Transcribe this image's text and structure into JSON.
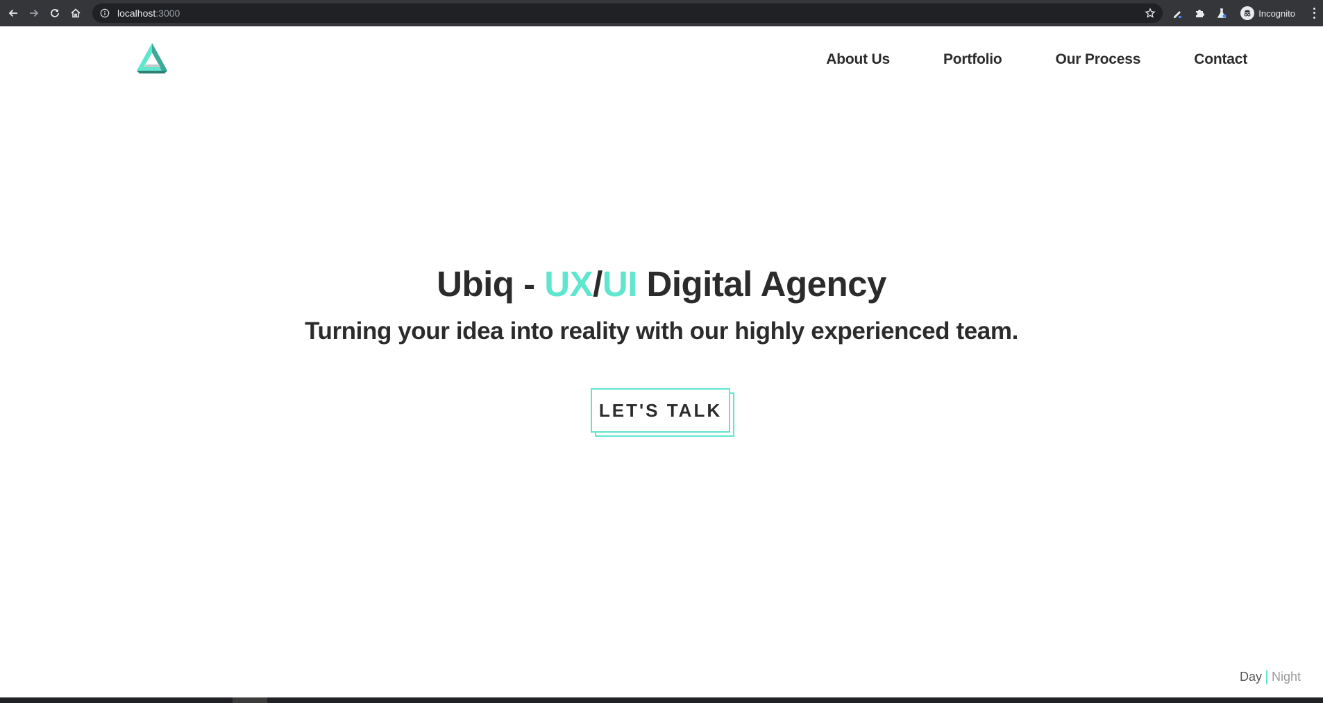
{
  "browser": {
    "url_host": "localhost",
    "url_port": ":3000",
    "profile_label": "Incognito",
    "icons": [
      "back-icon",
      "forward-icon",
      "reload-icon",
      "home-icon",
      "info-icon",
      "star-icon",
      "pen-extension-icon",
      "puzzle-extension-icon",
      "flask-extension-icon",
      "incognito-icon",
      "menu-icon"
    ]
  },
  "site": {
    "logo": "triangle-logo",
    "nav": [
      {
        "label": "About Us"
      },
      {
        "label": "Portfolio"
      },
      {
        "label": "Our Process"
      },
      {
        "label": "Contact"
      }
    ]
  },
  "hero": {
    "title_prefix": "Ubiq - ",
    "title_accent_1": "UX",
    "title_slash": "/",
    "title_accent_2": "UI",
    "title_suffix": " Digital Agency",
    "subtitle": "Turning your idea into reality with our highly experienced team.",
    "cta_label": "LET'S TALK"
  },
  "theme_toggle": {
    "day_label": "Day",
    "night_label": "Night"
  },
  "colors": {
    "accent": "#5ee6cf",
    "text": "#2b2b2b",
    "chrome_bg": "#35363a",
    "omnibox_bg": "#202124"
  }
}
